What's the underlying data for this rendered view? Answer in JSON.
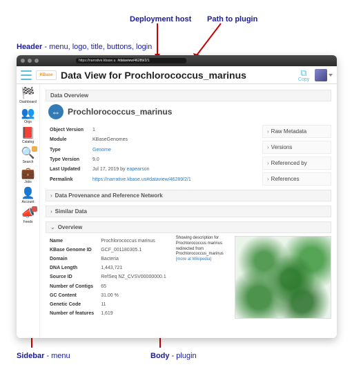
{
  "annotations": {
    "deploy_host": "Deployment host",
    "path_to_plugin": "Path to plugin",
    "header_label": "Header",
    "header_desc": " - menu, logo, title, buttons, login",
    "sidebar_label": "Sidebar",
    "sidebar_desc": " - menu",
    "body_label": "Body",
    "body_desc": " - plugin"
  },
  "addr": {
    "host": "https://narrative.kbase.u",
    "path": "#dataview/46289/2/1"
  },
  "header": {
    "logo_text": "KBase",
    "title": "Data View for Prochlorococcus_marinus",
    "copy_label": "Copy"
  },
  "sidebar": [
    {
      "icon": "◉",
      "label": "Dashboard",
      "badge": ""
    },
    {
      "icon": "👥",
      "label": "Orgs",
      "badge": ""
    },
    {
      "icon": "📖",
      "label": "Catalog",
      "badge": ""
    },
    {
      "icon": "🔍",
      "label": "Search",
      "badge": "orange"
    },
    {
      "icon": "💼",
      "label": "Jobs",
      "badge": ""
    },
    {
      "icon": "👤",
      "label": "Account",
      "badge": ""
    },
    {
      "icon": "📣",
      "label": "Feeds",
      "badge": "red"
    }
  ],
  "panels": {
    "data_overview": "Data Overview",
    "provenance": "Data Provenance and Reference Network",
    "similar": "Similar Data",
    "overview": "Overview"
  },
  "object_name": "Prochlorococcus_marinus",
  "meta_rows": [
    {
      "k": "Object Version",
      "v": "1"
    },
    {
      "k": "Module",
      "v": "KBaseGenomes"
    },
    {
      "k": "Type",
      "v": "Genome",
      "link": true
    },
    {
      "k": "Type Version",
      "v": "9.0"
    },
    {
      "k": "Last Updated",
      "v_prefix": "Jul 17, 2019 by ",
      "v": "eapearson",
      "link": true
    },
    {
      "k": "Permalink",
      "v": "https://narrative.kbase.us#dataview/46289/2/1",
      "link": true
    }
  ],
  "right_links": [
    "Raw Metadata",
    "Versions",
    "Referenced by",
    "References"
  ],
  "overview_rows": [
    {
      "k": "Name",
      "v": "Prochlorococcus marinus"
    },
    {
      "k": "KBase Genome ID",
      "v": "GCF_001180305.1"
    },
    {
      "k": "Domain",
      "v": "Bacteria"
    },
    {
      "k": "DNA Length",
      "v": "1,443,721"
    },
    {
      "k": "Source ID",
      "v": "RefSeq NZ_CVSV00000000.1"
    },
    {
      "k": "Number of Contigs",
      "v": "65"
    },
    {
      "k": "GC Content",
      "v": "31.00 %"
    },
    {
      "k": "Genetic Code",
      "v": "11"
    },
    {
      "k": "Number of features",
      "v": "1,619"
    }
  ],
  "desc": {
    "line1": "Showing description for Prochlorococcus marinus",
    "line2": "redirected from Prochlorococcus_marinus",
    "more": "[more at Wikipedia]"
  }
}
